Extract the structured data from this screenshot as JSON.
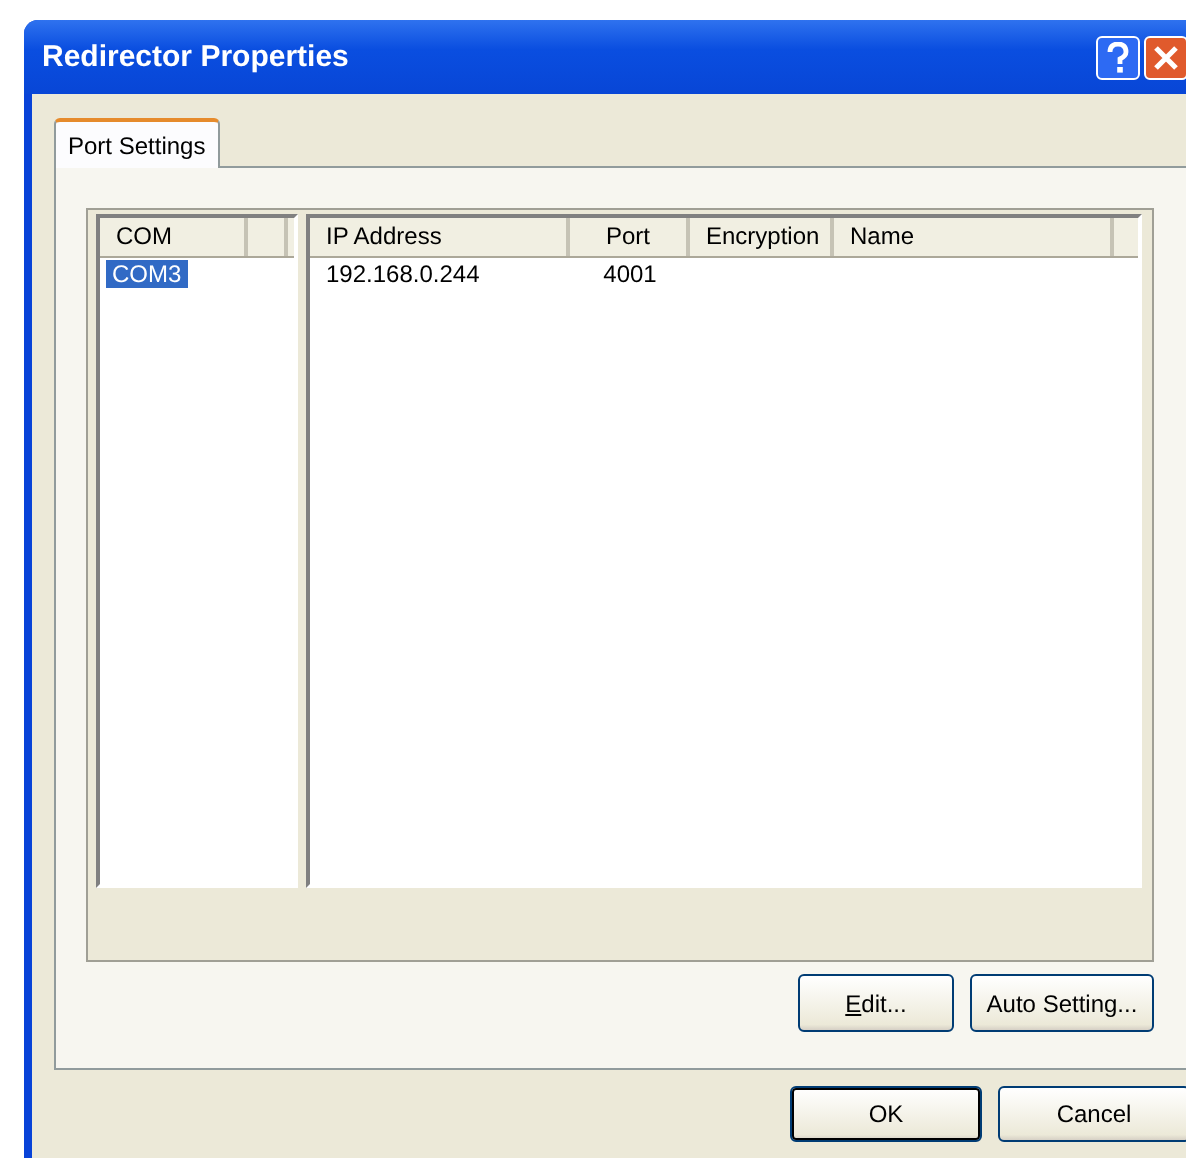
{
  "window": {
    "title": "Redirector Properties"
  },
  "tabs": [
    {
      "label": "Port Settings",
      "selected": true
    }
  ],
  "com_list": {
    "columns": [
      "COM"
    ],
    "rows": [
      {
        "com": "COM3",
        "selected": true
      }
    ]
  },
  "port_table": {
    "columns": [
      "IP Address",
      "Port",
      "Encryption",
      "Name"
    ],
    "rows": [
      {
        "ip_address": "192.168.0.244",
        "port": "4001",
        "selected": false
      }
    ]
  },
  "panel_buttons": [
    {
      "access_key": "E",
      "label": "dit..."
    },
    {
      "label": "Auto Setting..."
    }
  ],
  "buttons": [
    {
      "label": "OK",
      "default": true
    },
    {
      "label": "Cancel",
      "default": false
    }
  ]
}
